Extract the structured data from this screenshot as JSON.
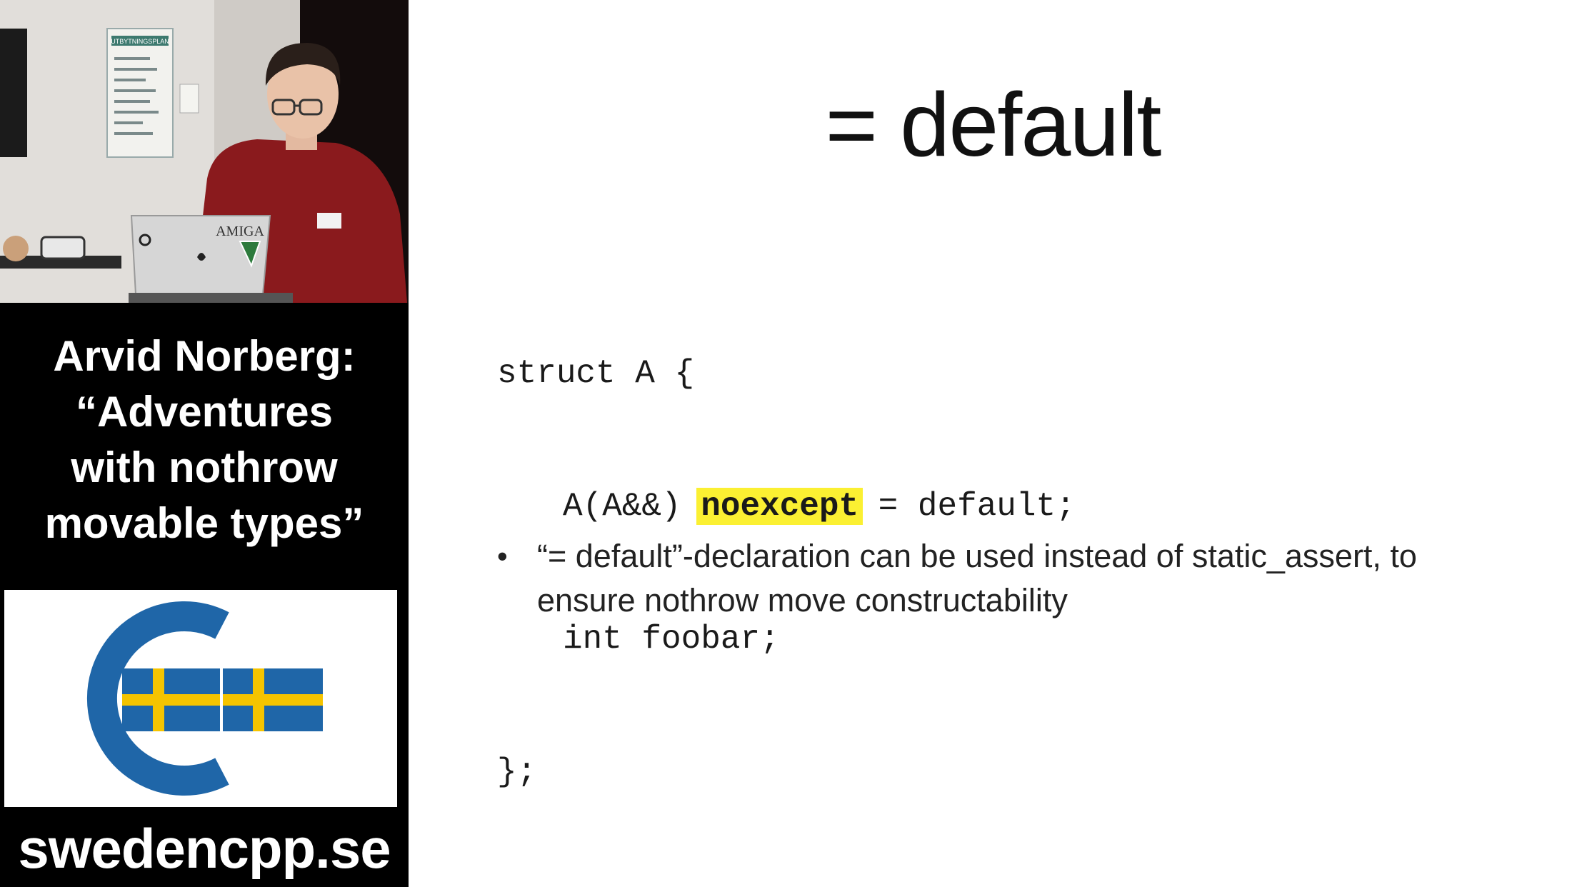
{
  "sidebar": {
    "talk_title_lines": [
      "Arvid Norberg:",
      "“Adventures",
      "with nothrow",
      "movable types”"
    ],
    "site_url": "swedencpp.se",
    "logo": {
      "name": "swedencpp-logo",
      "colors": {
        "blue": "#1f66a8",
        "yellow": "#f5c400",
        "ring": "#1f66a8"
      }
    },
    "video": {
      "poster_text": "UTBYTNINGSPLAN",
      "laptop_sticker": "AMIGA"
    }
  },
  "slide": {
    "title": "= default",
    "code": {
      "line1": "struct A {",
      "line2_prefix": "A(A&&) ",
      "line2_keyword": "noexcept",
      "line2_suffix": " = default;",
      "line3": "int foobar;",
      "line4": "};"
    },
    "highlight_color": "#fbf032",
    "bullet": "“= default”-declaration can be used instead of static_assert, to ensure nothrow move constructability"
  }
}
